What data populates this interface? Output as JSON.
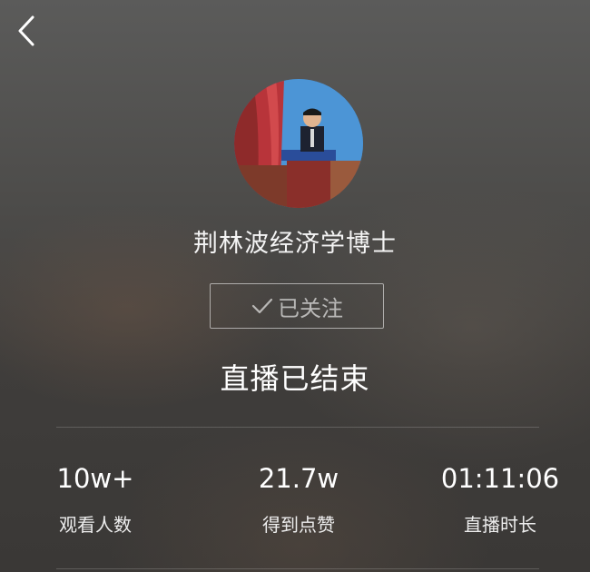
{
  "header": {
    "back_icon": "chevron-left-icon"
  },
  "profile": {
    "nickname": "荆林波经济学博士",
    "follow_label": "已关注",
    "follow_icon": "check-icon"
  },
  "status": {
    "title": "直播已结束"
  },
  "stats": [
    {
      "value": "10w+",
      "label": "观看人数"
    },
    {
      "value": "21.7w",
      "label": "得到点赞"
    },
    {
      "value": "01:11:06",
      "label": "直播时长"
    }
  ],
  "colors": {
    "background": "#4d4c4a",
    "text_primary": "#ffffff",
    "follow_border": "#8a8a8a"
  }
}
